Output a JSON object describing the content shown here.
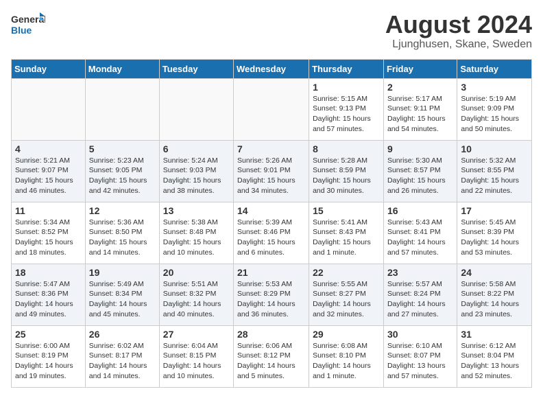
{
  "header": {
    "logo_line1": "General",
    "logo_line2": "Blue",
    "title": "August 2024",
    "subtitle": "Ljunghusen, Skane, Sweden"
  },
  "weekdays": [
    "Sunday",
    "Monday",
    "Tuesday",
    "Wednesday",
    "Thursday",
    "Friday",
    "Saturday"
  ],
  "weeks": [
    {
      "alt": false,
      "days": [
        {
          "num": "",
          "info": ""
        },
        {
          "num": "",
          "info": ""
        },
        {
          "num": "",
          "info": ""
        },
        {
          "num": "",
          "info": ""
        },
        {
          "num": "1",
          "info": "Sunrise: 5:15 AM\nSunset: 9:13 PM\nDaylight: 15 hours\nand 57 minutes."
        },
        {
          "num": "2",
          "info": "Sunrise: 5:17 AM\nSunset: 9:11 PM\nDaylight: 15 hours\nand 54 minutes."
        },
        {
          "num": "3",
          "info": "Sunrise: 5:19 AM\nSunset: 9:09 PM\nDaylight: 15 hours\nand 50 minutes."
        }
      ]
    },
    {
      "alt": true,
      "days": [
        {
          "num": "4",
          "info": "Sunrise: 5:21 AM\nSunset: 9:07 PM\nDaylight: 15 hours\nand 46 minutes."
        },
        {
          "num": "5",
          "info": "Sunrise: 5:23 AM\nSunset: 9:05 PM\nDaylight: 15 hours\nand 42 minutes."
        },
        {
          "num": "6",
          "info": "Sunrise: 5:24 AM\nSunset: 9:03 PM\nDaylight: 15 hours\nand 38 minutes."
        },
        {
          "num": "7",
          "info": "Sunrise: 5:26 AM\nSunset: 9:01 PM\nDaylight: 15 hours\nand 34 minutes."
        },
        {
          "num": "8",
          "info": "Sunrise: 5:28 AM\nSunset: 8:59 PM\nDaylight: 15 hours\nand 30 minutes."
        },
        {
          "num": "9",
          "info": "Sunrise: 5:30 AM\nSunset: 8:57 PM\nDaylight: 15 hours\nand 26 minutes."
        },
        {
          "num": "10",
          "info": "Sunrise: 5:32 AM\nSunset: 8:55 PM\nDaylight: 15 hours\nand 22 minutes."
        }
      ]
    },
    {
      "alt": false,
      "days": [
        {
          "num": "11",
          "info": "Sunrise: 5:34 AM\nSunset: 8:52 PM\nDaylight: 15 hours\nand 18 minutes."
        },
        {
          "num": "12",
          "info": "Sunrise: 5:36 AM\nSunset: 8:50 PM\nDaylight: 15 hours\nand 14 minutes."
        },
        {
          "num": "13",
          "info": "Sunrise: 5:38 AM\nSunset: 8:48 PM\nDaylight: 15 hours\nand 10 minutes."
        },
        {
          "num": "14",
          "info": "Sunrise: 5:39 AM\nSunset: 8:46 PM\nDaylight: 15 hours\nand 6 minutes."
        },
        {
          "num": "15",
          "info": "Sunrise: 5:41 AM\nSunset: 8:43 PM\nDaylight: 15 hours\nand 1 minute."
        },
        {
          "num": "16",
          "info": "Sunrise: 5:43 AM\nSunset: 8:41 PM\nDaylight: 14 hours\nand 57 minutes."
        },
        {
          "num": "17",
          "info": "Sunrise: 5:45 AM\nSunset: 8:39 PM\nDaylight: 14 hours\nand 53 minutes."
        }
      ]
    },
    {
      "alt": true,
      "days": [
        {
          "num": "18",
          "info": "Sunrise: 5:47 AM\nSunset: 8:36 PM\nDaylight: 14 hours\nand 49 minutes."
        },
        {
          "num": "19",
          "info": "Sunrise: 5:49 AM\nSunset: 8:34 PM\nDaylight: 14 hours\nand 45 minutes."
        },
        {
          "num": "20",
          "info": "Sunrise: 5:51 AM\nSunset: 8:32 PM\nDaylight: 14 hours\nand 40 minutes."
        },
        {
          "num": "21",
          "info": "Sunrise: 5:53 AM\nSunset: 8:29 PM\nDaylight: 14 hours\nand 36 minutes."
        },
        {
          "num": "22",
          "info": "Sunrise: 5:55 AM\nSunset: 8:27 PM\nDaylight: 14 hours\nand 32 minutes."
        },
        {
          "num": "23",
          "info": "Sunrise: 5:57 AM\nSunset: 8:24 PM\nDaylight: 14 hours\nand 27 minutes."
        },
        {
          "num": "24",
          "info": "Sunrise: 5:58 AM\nSunset: 8:22 PM\nDaylight: 14 hours\nand 23 minutes."
        }
      ]
    },
    {
      "alt": false,
      "days": [
        {
          "num": "25",
          "info": "Sunrise: 6:00 AM\nSunset: 8:19 PM\nDaylight: 14 hours\nand 19 minutes."
        },
        {
          "num": "26",
          "info": "Sunrise: 6:02 AM\nSunset: 8:17 PM\nDaylight: 14 hours\nand 14 minutes."
        },
        {
          "num": "27",
          "info": "Sunrise: 6:04 AM\nSunset: 8:15 PM\nDaylight: 14 hours\nand 10 minutes."
        },
        {
          "num": "28",
          "info": "Sunrise: 6:06 AM\nSunset: 8:12 PM\nDaylight: 14 hours\nand 5 minutes."
        },
        {
          "num": "29",
          "info": "Sunrise: 6:08 AM\nSunset: 8:10 PM\nDaylight: 14 hours\nand 1 minute."
        },
        {
          "num": "30",
          "info": "Sunrise: 6:10 AM\nSunset: 8:07 PM\nDaylight: 13 hours\nand 57 minutes."
        },
        {
          "num": "31",
          "info": "Sunrise: 6:12 AM\nSunset: 8:04 PM\nDaylight: 13 hours\nand 52 minutes."
        }
      ]
    }
  ]
}
